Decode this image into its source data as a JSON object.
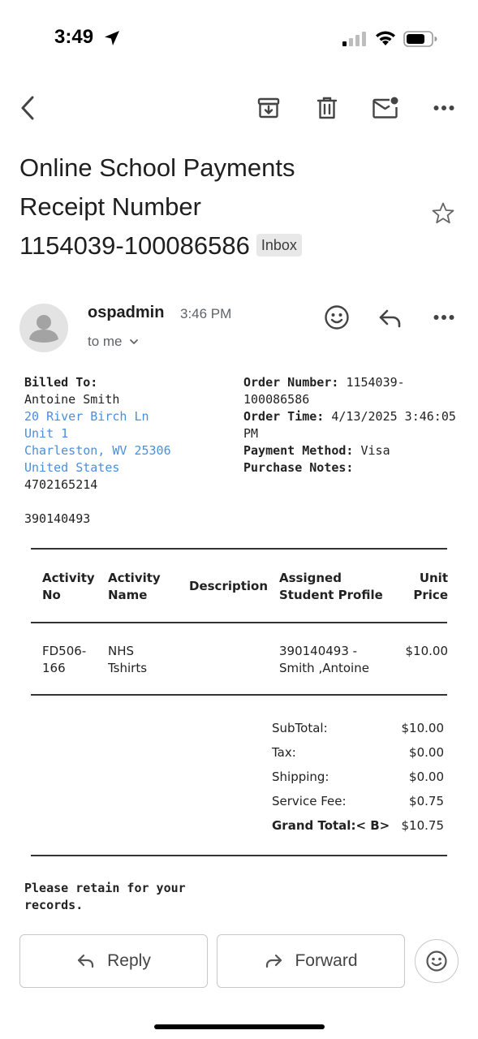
{
  "status_bar": {
    "time": "3:49"
  },
  "toolbar": {
    "back_icon": "chevron-left-icon",
    "archive_icon": "archive-icon",
    "delete_icon": "trash-icon",
    "mark_unread_icon": "mail-unread-icon",
    "more_icon": "more-horizontal-icon"
  },
  "email": {
    "subject_lines": [
      "Online School Payments",
      "Receipt Number",
      "1154039-100086586"
    ],
    "label": "Inbox",
    "sender": "ospadmin",
    "time": "3:46 PM",
    "to": "to me"
  },
  "billing": {
    "heading": "Billed To:",
    "name": "Antoine Smith",
    "address_lines": [
      "20 River Birch Ln",
      "Unit 1",
      "Charleston, WV 25306",
      "United States"
    ],
    "phone": "4702165214",
    "student_id": "390140493"
  },
  "order": {
    "number_label": "Order Number:",
    "number_value_1": "1154039-",
    "number_value_2": "100086586",
    "time_label": "Order Time:",
    "time_value_1": "4/13/2025 3:46:05",
    "time_value_2": "PM",
    "method_label": "Payment Method:",
    "method_value": "Visa",
    "notes_label": "Purchase Notes:"
  },
  "table": {
    "headers": {
      "activity_no": [
        "Activity",
        "No"
      ],
      "activity_name": [
        "Activity",
        "Name"
      ],
      "description": "Description",
      "assigned": [
        "Assigned",
        "Student Profile"
      ],
      "unit_price": [
        "Unit",
        "Price"
      ]
    },
    "rows": [
      {
        "activity_no": [
          "FD506-",
          "166"
        ],
        "activity_name": [
          "NHS",
          "Tshirts"
        ],
        "description": "",
        "assigned": [
          "390140493 -",
          "Smith ,Antoine"
        ],
        "unit_price": "$10.00"
      }
    ]
  },
  "totals": {
    "subtotal_label": "SubTotal:",
    "subtotal": "$10.00",
    "tax_label": "Tax:",
    "tax": "$0.00",
    "shipping_label": "Shipping:",
    "shipping": "$0.00",
    "fee_label": "Service Fee:",
    "fee": "$0.75",
    "grand_label": "Grand Total:< B>",
    "grand": "$10.75"
  },
  "footer_note": [
    "Please retain for your",
    "records."
  ],
  "actions": {
    "reply": "Reply",
    "forward": "Forward"
  }
}
